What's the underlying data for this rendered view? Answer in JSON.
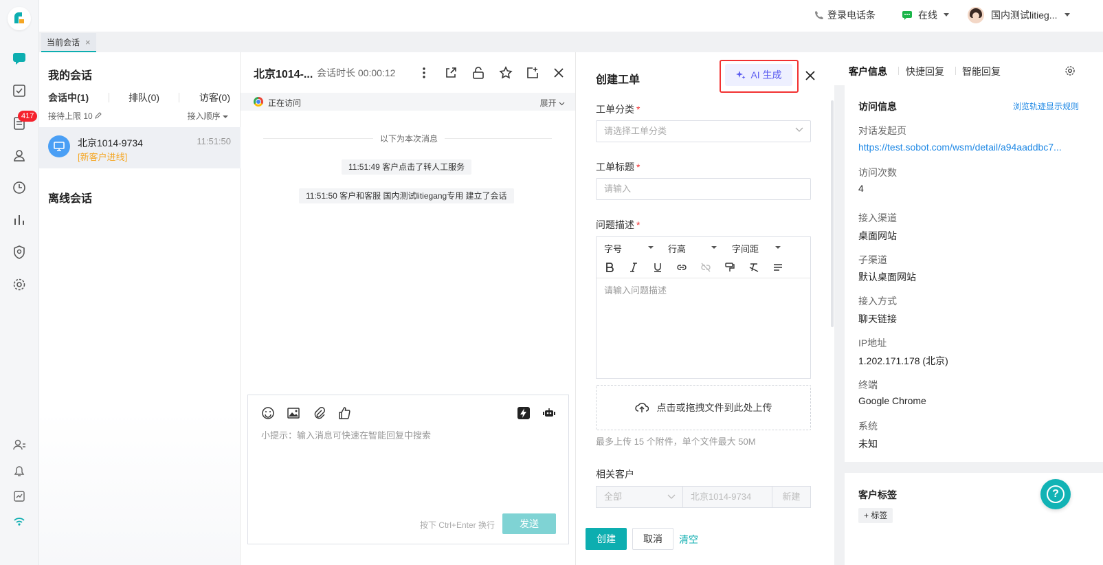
{
  "rail": {
    "badge": "417",
    "icons": [
      "chat-icon",
      "checkbox-icon",
      "document-icon",
      "user-icon",
      "clock-icon",
      "bar-chart-icon",
      "shield-icon",
      "gear-icon",
      "user-setting-icon",
      "bell-icon",
      "inbox-icon",
      "wifi-icon"
    ]
  },
  "topbar": {
    "phone_label": "登录电话条",
    "status_label": "在线",
    "user_name": "国内测试litieg..."
  },
  "tabs": {
    "current": "当前会话",
    "close": "×"
  },
  "convlist": {
    "title": "我的会话",
    "tab_active": "会话中(1)",
    "tab_queue": "排队(0)",
    "tab_visitors": "访客(0)",
    "limit": "接待上限 10",
    "order": "接入顺序",
    "item": {
      "name": "北京1014-9734",
      "tag": "[新客户进线]",
      "time": "11:51:50"
    },
    "offline_title": "离线会话"
  },
  "chat": {
    "title": "北京1014-...",
    "duration": "会话时长 00:00:12",
    "visiting": "正在访问",
    "expand": "展开",
    "divider": "以下为本次消息",
    "messages": [
      "11:51:49 客户点击了转人工服务",
      "11:51:50 客户和客服 国内测试litiegang专用 建立了会话"
    ],
    "input_hint": "小提示：输入消息可快速在智能回复中搜索",
    "shortcut_hint": "按下 Ctrl+Enter 换行",
    "send": "发送"
  },
  "ticket": {
    "title": "创建工单",
    "ai_button": "AI 生成",
    "category_label": "工单分类",
    "category_placeholder": "请选择工单分类",
    "subject_label": "工单标题",
    "subject_placeholder": "请输入",
    "desc_label": "问题描述",
    "font_size": "字号",
    "line_height": "行高",
    "letter_spacing": "字间距",
    "desc_placeholder": "请输入问题描述",
    "upload": "点击或拖拽文件到此处上传",
    "upload_note": "最多上传 15 个附件，单个文件最大 50M",
    "related_label": "相关客户",
    "related_scope": "全部",
    "related_customer": "北京1014-9734",
    "related_new": "新建",
    "create": "创建",
    "cancel": "取消",
    "clear": "清空",
    "required_mark": "*"
  },
  "info": {
    "tab_customer": "客户信息",
    "tab_quick": "快捷回复",
    "tab_smart": "智能回复",
    "section": "访问信息",
    "rule_link": "浏览轨迹显示规则",
    "fields": [
      {
        "k": "对话发起页",
        "v": "https://test.sobot.com/wsm/detail/a94aaddbc7..."
      },
      {
        "k": "访问次数",
        "v": "4"
      },
      {
        "k": "接入渠道",
        "v": "桌面网站"
      },
      {
        "k": "子渠道",
        "v": "默认桌面网站"
      },
      {
        "k": "接入方式",
        "v": "聊天链接"
      },
      {
        "k": "IP地址",
        "v": "1.202.171.178 (北京)"
      },
      {
        "k": "终端",
        "v": "Google Chrome"
      },
      {
        "k": "系统",
        "v": "未知"
      }
    ],
    "tags_title": "客户标签",
    "add_tag": "+ 标签"
  },
  "help": "?",
  "colors": {
    "accent": "#0daeb0",
    "ai": "#5b5cf0",
    "highlight": "#f23030",
    "badge": "#f5222d",
    "tag_new": "#f5a623",
    "link": "#1e88e5"
  }
}
